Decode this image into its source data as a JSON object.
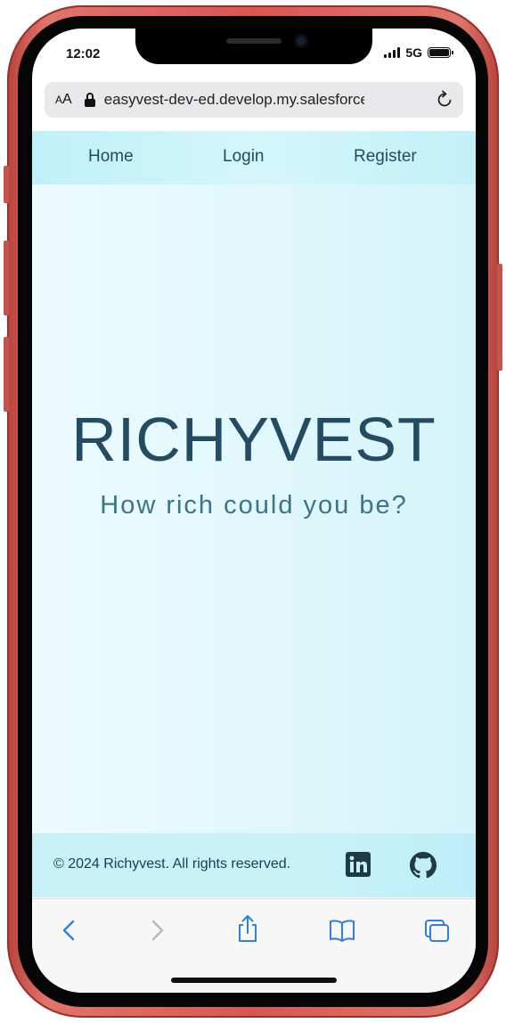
{
  "status_bar": {
    "time": "12:02",
    "network": "5G"
  },
  "browser": {
    "text_size_label_small": "A",
    "text_size_label_large": "A",
    "url": "easyvest-dev-ed.develop.my.salesforce"
  },
  "nav": {
    "items": [
      {
        "label": "Home"
      },
      {
        "label": "Login"
      },
      {
        "label": "Register"
      }
    ]
  },
  "hero": {
    "title": "RICHYVEST",
    "subtitle": "How rich could you be?"
  },
  "footer": {
    "copyright": "© 2024 Richyvest. All rights reserved."
  },
  "icons": {
    "linkedin": "linkedin-icon",
    "github": "github-icon",
    "back": "chevron-left-icon",
    "forward": "chevron-right-icon",
    "share": "share-icon",
    "bookmarks": "book-icon",
    "tabs": "tabs-icon",
    "reload": "reload-icon",
    "lock": "lock-icon"
  },
  "colors": {
    "frame": "#d8584f",
    "nav_bg": "#bff1f8",
    "page_bg": "#e3f8fb",
    "title": "#234c63",
    "subtitle": "#3c7389",
    "toolbar_icon": "#2f7ee0"
  }
}
